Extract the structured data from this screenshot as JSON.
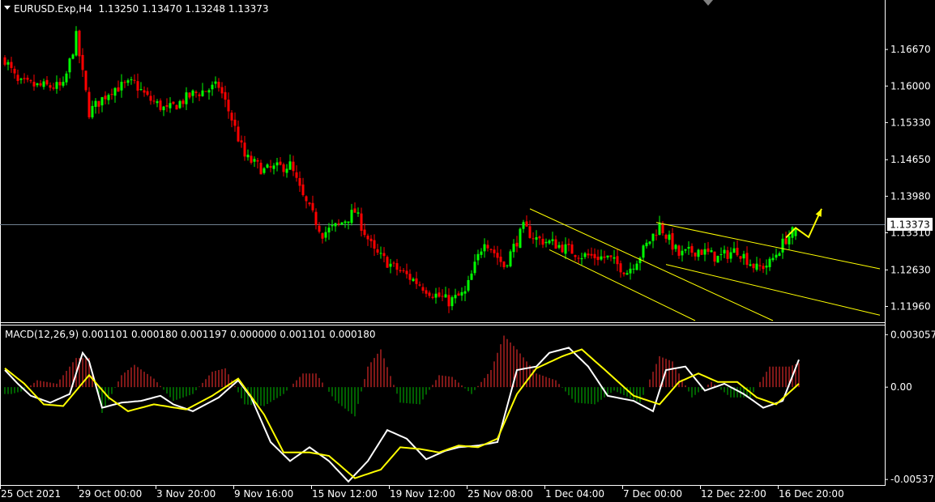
{
  "symbol_header": {
    "text": "EURUSD.Exp,H4  1.13250 1.13470 1.13248 1.13373"
  },
  "macd_header": {
    "text": "MACD(12,26,9) 0.001101 0.000180 0.001197 0.000000 0.001101 0.000180"
  },
  "current_price": "1.13373",
  "colors": {
    "background": "#000000",
    "bull_candle": "#00ff00",
    "bear_candle": "#ff0000",
    "channel_lines": "#ffff00",
    "arrow": "#ffff00",
    "macd_line": "#ffffff",
    "signal_line": "#ffff00",
    "hist_positive": "#ff3030",
    "hist_negative": "#00c000",
    "axis_text": "#ffffff",
    "price_line": "#708090"
  },
  "chart_data": [
    {
      "type": "candlestick",
      "title": "EURUSD.Exp,H4",
      "ohlc_last": {
        "open": 1.1325,
        "high": 1.1347,
        "low": 1.13248,
        "close": 1.13373
      },
      "ylim": [
        1.117,
        1.1728
      ],
      "y_ticks": [
        "1.16670",
        "1.16000",
        "1.15330",
        "1.14650",
        "1.13980",
        "1.13310",
        "1.12630",
        "1.11960"
      ],
      "x_ticks": [
        "25 Oct 2021",
        "29 Oct 00:00",
        "3 Nov 20:00",
        "9 Nov 16:00",
        "15 Nov 12:00",
        "19 Nov 12:00",
        "25 Nov 08:00",
        "1 Dec 04:00",
        "7 Dec 00:00",
        "12 Dec 22:00",
        "16 Dec 20:00"
      ],
      "close_trend": [
        {
          "t": 0,
          "price": 1.165
        },
        {
          "t": 4,
          "price": 1.1605
        },
        {
          "t": 10,
          "price": 1.16
        },
        {
          "t": 18,
          "price": 1.1598
        },
        {
          "t": 22,
          "price": 1.169
        },
        {
          "t": 26,
          "price": 1.1552
        },
        {
          "t": 33,
          "price": 1.1595
        },
        {
          "t": 40,
          "price": 1.1605
        },
        {
          "t": 44,
          "price": 1.1578
        },
        {
          "t": 50,
          "price": 1.1555
        },
        {
          "t": 58,
          "price": 1.1585
        },
        {
          "t": 66,
          "price": 1.16
        },
        {
          "t": 70,
          "price": 1.154
        },
        {
          "t": 74,
          "price": 1.147
        },
        {
          "t": 80,
          "price": 1.1445
        },
        {
          "t": 88,
          "price": 1.1455
        },
        {
          "t": 92,
          "price": 1.1395
        },
        {
          "t": 98,
          "price": 1.133
        },
        {
          "t": 103,
          "price": 1.1345
        },
        {
          "t": 108,
          "price": 1.137
        },
        {
          "t": 114,
          "price": 1.1295
        },
        {
          "t": 120,
          "price": 1.1268
        },
        {
          "t": 126,
          "price": 1.1245
        },
        {
          "t": 132,
          "price": 1.122
        },
        {
          "t": 137,
          "price": 1.1205
        },
        {
          "t": 142,
          "price": 1.122
        },
        {
          "t": 148,
          "price": 1.132
        },
        {
          "t": 154,
          "price": 1.127
        },
        {
          "t": 160,
          "price": 1.134
        },
        {
          "t": 164,
          "price": 1.132
        },
        {
          "t": 170,
          "price": 1.131
        },
        {
          "t": 178,
          "price": 1.129
        },
        {
          "t": 186,
          "price": 1.1285
        },
        {
          "t": 192,
          "price": 1.126
        },
        {
          "t": 196,
          "price": 1.129
        },
        {
          "t": 202,
          "price": 1.1345
        },
        {
          "t": 208,
          "price": 1.129
        },
        {
          "t": 214,
          "price": 1.13
        },
        {
          "t": 220,
          "price": 1.1285
        },
        {
          "t": 226,
          "price": 1.13
        },
        {
          "t": 232,
          "price": 1.1265
        },
        {
          "t": 236,
          "price": 1.1275
        },
        {
          "t": 241,
          "price": 1.132
        },
        {
          "t": 244,
          "price": 1.1337
        }
      ],
      "channels": [
        {
          "from": {
            "t": 162,
            "price": 1.1375
          },
          "to": {
            "t": 237,
            "price": 1.117
          }
        },
        {
          "from": {
            "t": 168,
            "price": 1.13
          },
          "to": {
            "t": 213,
            "price": 1.117
          }
        },
        {
          "from": {
            "t": 201,
            "price": 1.135
          },
          "to": {
            "t": 270,
            "price": 1.1265
          }
        },
        {
          "from": {
            "t": 204,
            "price": 1.1273
          },
          "to": {
            "t": 270,
            "price": 1.118
          }
        }
      ],
      "arrow_path": [
        {
          "t": 241,
          "price": 1.1322
        },
        {
          "t": 244,
          "price": 1.134
        },
        {
          "t": 248,
          "price": 1.1323
        },
        {
          "t": 252,
          "price": 1.1375
        }
      ]
    },
    {
      "type": "line",
      "title": "MACD(12,26,9)",
      "ylim": [
        -0.00565,
        0.00345
      ],
      "y_ticks": [
        "0.003057",
        "0.00",
        "-0.005376"
      ],
      "series": [
        {
          "name": "MACD",
          "points": [
            {
              "t": 0,
              "value": 0.001
            },
            {
              "t": 4,
              "value": 0.0002
            },
            {
              "t": 8,
              "value": -0.0005
            },
            {
              "t": 14,
              "value": -0.0009
            },
            {
              "t": 20,
              "value": -0.0004
            },
            {
              "t": 24,
              "value": 0.002
            },
            {
              "t": 26,
              "value": 0.0015
            },
            {
              "t": 30,
              "value": -0.0012
            },
            {
              "t": 36,
              "value": -0.0009
            },
            {
              "t": 42,
              "value": -0.0008
            },
            {
              "t": 48,
              "value": -0.0005
            },
            {
              "t": 52,
              "value": -0.001
            },
            {
              "t": 58,
              "value": -0.0014
            },
            {
              "t": 66,
              "value": -0.0006
            },
            {
              "t": 72,
              "value": 0.0004
            },
            {
              "t": 76,
              "value": -0.0006
            },
            {
              "t": 82,
              "value": -0.0032
            },
            {
              "t": 88,
              "value": -0.0043
            },
            {
              "t": 94,
              "value": -0.0035
            },
            {
              "t": 100,
              "value": -0.0043
            },
            {
              "t": 106,
              "value": -0.0055
            },
            {
              "t": 112,
              "value": -0.0043
            },
            {
              "t": 118,
              "value": -0.0025
            },
            {
              "t": 124,
              "value": -0.003
            },
            {
              "t": 130,
              "value": -0.0042
            },
            {
              "t": 136,
              "value": -0.0037
            },
            {
              "t": 140,
              "value": -0.0035
            },
            {
              "t": 146,
              "value": -0.0034
            },
            {
              "t": 152,
              "value": -0.0032
            },
            {
              "t": 158,
              "value": 0.001
            },
            {
              "t": 164,
              "value": 0.0012
            },
            {
              "t": 168,
              "value": 0.002
            },
            {
              "t": 174,
              "value": 0.0023
            },
            {
              "t": 180,
              "value": 0.0012
            },
            {
              "t": 186,
              "value": -0.0005
            },
            {
              "t": 194,
              "value": -0.0008
            },
            {
              "t": 200,
              "value": -0.0014
            },
            {
              "t": 204,
              "value": 0.001
            },
            {
              "t": 210,
              "value": 0.0012
            },
            {
              "t": 216,
              "value": -0.0002
            },
            {
              "t": 222,
              "value": 0.0002
            },
            {
              "t": 228,
              "value": -0.0004
            },
            {
              "t": 234,
              "value": -0.0012
            },
            {
              "t": 240,
              "value": -0.0008
            },
            {
              "t": 245,
              "value": 0.0016
            }
          ]
        },
        {
          "name": "Signal",
          "points": [
            {
              "t": 0,
              "value": 0.0011
            },
            {
              "t": 6,
              "value": 0.0002
            },
            {
              "t": 12,
              "value": -0.001
            },
            {
              "t": 18,
              "value": -0.0011
            },
            {
              "t": 26,
              "value": 0.0007
            },
            {
              "t": 32,
              "value": -0.0006
            },
            {
              "t": 38,
              "value": -0.0014
            },
            {
              "t": 46,
              "value": -0.001
            },
            {
              "t": 56,
              "value": -0.0013
            },
            {
              "t": 64,
              "value": -0.0005
            },
            {
              "t": 72,
              "value": 0.0005
            },
            {
              "t": 80,
              "value": -0.0016
            },
            {
              "t": 86,
              "value": -0.0038
            },
            {
              "t": 94,
              "value": -0.0038
            },
            {
              "t": 100,
              "value": -0.004
            },
            {
              "t": 108,
              "value": -0.0053
            },
            {
              "t": 116,
              "value": -0.0048
            },
            {
              "t": 122,
              "value": -0.0035
            },
            {
              "t": 128,
              "value": -0.0036
            },
            {
              "t": 134,
              "value": -0.0038
            },
            {
              "t": 140,
              "value": -0.0034
            },
            {
              "t": 146,
              "value": -0.0035
            },
            {
              "t": 152,
              "value": -0.003
            },
            {
              "t": 158,
              "value": -0.0004
            },
            {
              "t": 164,
              "value": 0.0011
            },
            {
              "t": 172,
              "value": 0.0018
            },
            {
              "t": 178,
              "value": 0.0022
            },
            {
              "t": 184,
              "value": 0.0012
            },
            {
              "t": 194,
              "value": -0.0005
            },
            {
              "t": 202,
              "value": -0.001
            },
            {
              "t": 208,
              "value": 0.0003
            },
            {
              "t": 214,
              "value": 0.0008
            },
            {
              "t": 220,
              "value": 0.0003
            },
            {
              "t": 226,
              "value": 0.0003
            },
            {
              "t": 232,
              "value": -0.0006
            },
            {
              "t": 238,
              "value": -0.001
            },
            {
              "t": 245,
              "value": 0.0002
            }
          ]
        }
      ],
      "histogram": [
        {
          "t": 2,
          "value": -0.0004
        },
        {
          "t": 6,
          "value": -0.0002
        },
        {
          "t": 10,
          "value": 0.0004
        },
        {
          "t": 16,
          "value": 0.0002
        },
        {
          "t": 22,
          "value": 0.0017
        },
        {
          "t": 26,
          "value": 0.0017
        },
        {
          "t": 30,
          "value": -0.0015
        },
        {
          "t": 36,
          "value": 0.0007
        },
        {
          "t": 40,
          "value": 0.0013
        },
        {
          "t": 46,
          "value": 0.0005
        },
        {
          "t": 52,
          "value": -0.0008
        },
        {
          "t": 58,
          "value": -0.0004
        },
        {
          "t": 64,
          "value": 0.0009
        },
        {
          "t": 68,
          "value": 0.0011
        },
        {
          "t": 74,
          "value": -0.001
        },
        {
          "t": 80,
          "value": -0.0011
        },
        {
          "t": 86,
          "value": -0.0004
        },
        {
          "t": 92,
          "value": 0.0008
        },
        {
          "t": 96,
          "value": 0.0008
        },
        {
          "t": 102,
          "value": -0.0008
        },
        {
          "t": 108,
          "value": -0.0017
        },
        {
          "t": 112,
          "value": 0.0012
        },
        {
          "t": 116,
          "value": 0.0022
        },
        {
          "t": 122,
          "value": -0.0009
        },
        {
          "t": 128,
          "value": -0.001
        },
        {
          "t": 134,
          "value": 0.0007
        },
        {
          "t": 138,
          "value": 0.0006
        },
        {
          "t": 144,
          "value": -0.0004
        },
        {
          "t": 150,
          "value": 0.001
        },
        {
          "t": 154,
          "value": 0.003
        },
        {
          "t": 158,
          "value": 0.0022
        },
        {
          "t": 164,
          "value": 0.0008
        },
        {
          "t": 170,
          "value": 0.0004
        },
        {
          "t": 176,
          "value": -0.0009
        },
        {
          "t": 182,
          "value": -0.001
        },
        {
          "t": 188,
          "value": -0.0002
        },
        {
          "t": 196,
          "value": -0.0009
        },
        {
          "t": 202,
          "value": 0.0018
        },
        {
          "t": 206,
          "value": 0.0015
        },
        {
          "t": 212,
          "value": -0.0006
        },
        {
          "t": 218,
          "value": 0.0003
        },
        {
          "t": 224,
          "value": -0.0006
        },
        {
          "t": 230,
          "value": -0.0006
        },
        {
          "t": 236,
          "value": 0.0012
        },
        {
          "t": 242,
          "value": 0.0012
        },
        {
          "t": 245,
          "value": 0.0014
        }
      ]
    }
  ]
}
